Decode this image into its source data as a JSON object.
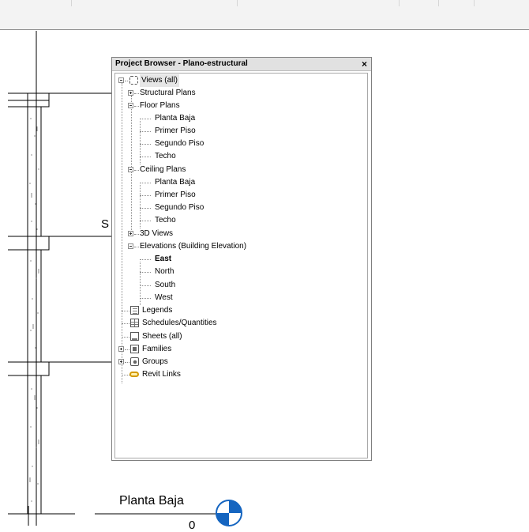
{
  "browser": {
    "title": "Project Browser - Plano-estructural",
    "close_glyph": "×",
    "tree": {
      "views": "Views (all)",
      "structural_plans": "Structural Plans",
      "floor_plans": {
        "label": "Floor Plans",
        "items": [
          "Planta Baja",
          "Primer Piso",
          "Segundo Piso",
          "Techo"
        ]
      },
      "ceiling_plans": {
        "label": "Ceiling Plans",
        "items": [
          "Planta Baja",
          "Primer Piso",
          "Segundo Piso",
          "Techo"
        ]
      },
      "views_3d": "3D Views",
      "elevations": {
        "label": "Elevations (Building Elevation)",
        "items": [
          "East",
          "North",
          "South",
          "West"
        ]
      },
      "legends": "Legends",
      "schedules": "Schedules/Quantities",
      "sheets": "Sheets (all)",
      "families": "Families",
      "groups": "Groups",
      "revit_links": "Revit Links"
    }
  },
  "drawing": {
    "level_name": "Planta Baja",
    "level_elevation": "0",
    "partial_label": "S"
  },
  "colors": {
    "elevation_marker": "#1565c0",
    "selection": "#e6e6e6",
    "title_bar": "#e1e1e1"
  }
}
